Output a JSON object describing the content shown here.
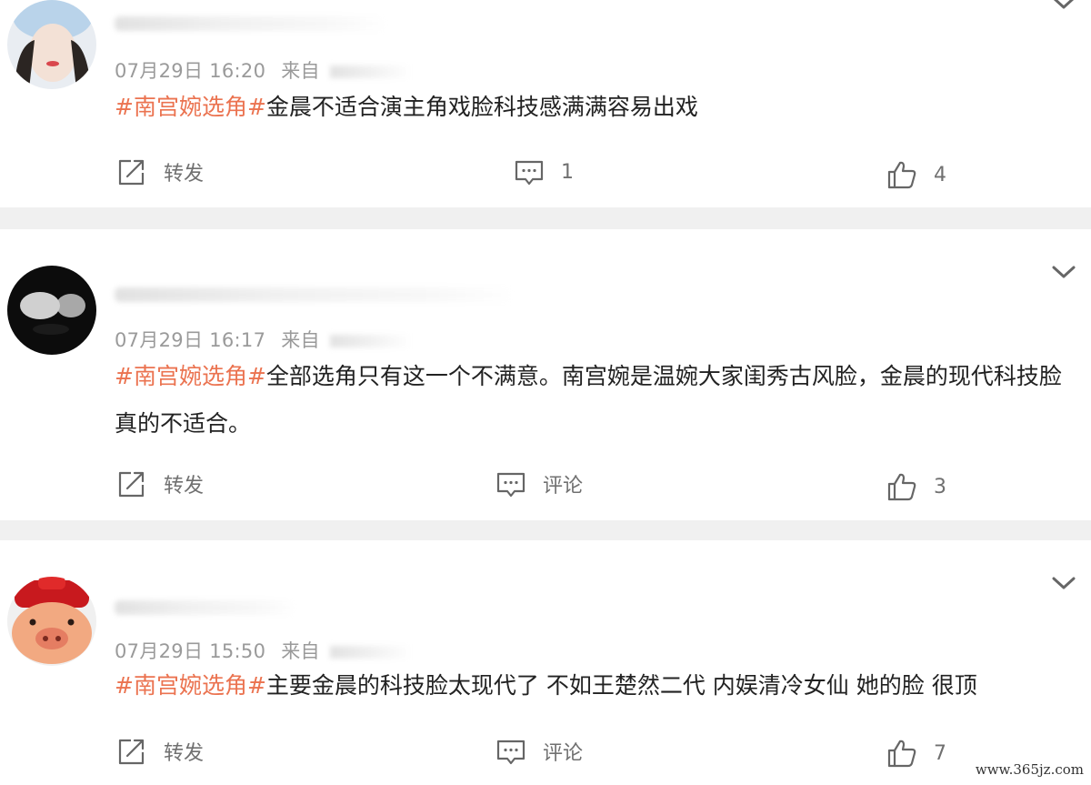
{
  "theme": {
    "tag_color": "#eb7350",
    "meta_color": "#9a9a9a",
    "separator_color": "#f0f0f0"
  },
  "posts": [
    {
      "timestamp": "07月29日 16:20",
      "source_prefix": "来自",
      "hashtag": "#南宫婉选角#",
      "text": "金晨不适合演主角戏脸科技感满满容易出戏",
      "actions": {
        "repost": "转发",
        "comment": "1",
        "likes": "4"
      }
    },
    {
      "timestamp": "07月29日 16:17",
      "source_prefix": "来自",
      "hashtag": "#南宫婉选角#",
      "text": "全部选角只有这一个不满意。南宫婉是温婉大家闺秀古风脸，金晨的现代科技脸真的不适合。",
      "actions": {
        "repost": "转发",
        "comment": "评论",
        "likes": "3"
      }
    },
    {
      "timestamp": "07月29日 15:50",
      "source_prefix": "来自",
      "hashtag": "#南宫婉选角#",
      "text": "主要金晨的科技脸太现代了 不如王楚然二代 内娱清冷女仙 她的脸 很顶",
      "actions": {
        "repost": "转发",
        "comment": "评论",
        "likes": "7"
      }
    }
  ],
  "icons": {
    "repost": "share-icon",
    "comment": "comment-icon",
    "like": "thumbs-up-icon",
    "more": "chevron-down-icon"
  },
  "watermark": "www.365jz.com"
}
